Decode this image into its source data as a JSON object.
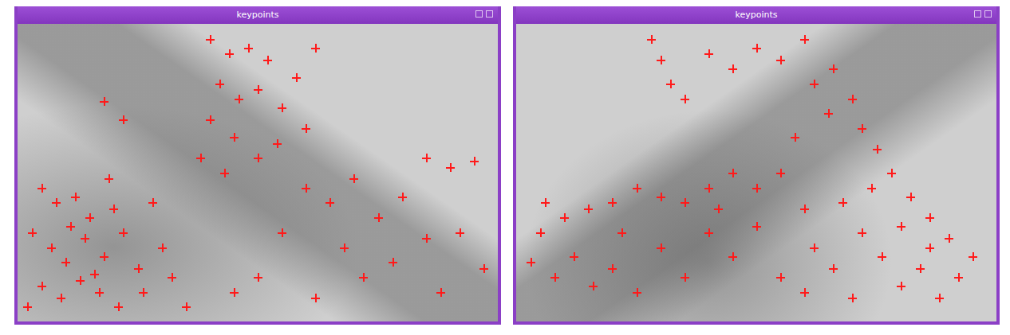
{
  "windows": [
    {
      "title": "keypoints",
      "keypoints": [
        [
          0.05,
          0.55
        ],
        [
          0.08,
          0.6
        ],
        [
          0.12,
          0.58
        ],
        [
          0.15,
          0.65
        ],
        [
          0.03,
          0.7
        ],
        [
          0.07,
          0.75
        ],
        [
          0.1,
          0.8
        ],
        [
          0.14,
          0.72
        ],
        [
          0.18,
          0.78
        ],
        [
          0.2,
          0.62
        ],
        [
          0.22,
          0.7
        ],
        [
          0.25,
          0.82
        ],
        [
          0.05,
          0.88
        ],
        [
          0.09,
          0.92
        ],
        [
          0.13,
          0.86
        ],
        [
          0.17,
          0.9
        ],
        [
          0.21,
          0.95
        ],
        [
          0.26,
          0.9
        ],
        [
          0.3,
          0.75
        ],
        [
          0.32,
          0.85
        ],
        [
          0.28,
          0.6
        ],
        [
          0.35,
          0.95
        ],
        [
          0.02,
          0.95
        ],
        [
          0.11,
          0.68
        ],
        [
          0.19,
          0.52
        ],
        [
          0.16,
          0.84
        ],
        [
          0.4,
          0.05
        ],
        [
          0.44,
          0.1
        ],
        [
          0.48,
          0.08
        ],
        [
          0.52,
          0.12
        ],
        [
          0.42,
          0.2
        ],
        [
          0.46,
          0.25
        ],
        [
          0.5,
          0.22
        ],
        [
          0.55,
          0.28
        ],
        [
          0.58,
          0.18
        ],
        [
          0.4,
          0.32
        ],
        [
          0.45,
          0.38
        ],
        [
          0.5,
          0.45
        ],
        [
          0.38,
          0.45
        ],
        [
          0.43,
          0.5
        ],
        [
          0.54,
          0.4
        ],
        [
          0.6,
          0.35
        ],
        [
          0.62,
          0.08
        ],
        [
          0.18,
          0.26
        ],
        [
          0.22,
          0.32
        ],
        [
          0.6,
          0.55
        ],
        [
          0.65,
          0.6
        ],
        [
          0.7,
          0.52
        ],
        [
          0.75,
          0.65
        ],
        [
          0.8,
          0.58
        ],
        [
          0.85,
          0.45
        ],
        [
          0.9,
          0.48
        ],
        [
          0.95,
          0.46
        ],
        [
          0.68,
          0.75
        ],
        [
          0.72,
          0.85
        ],
        [
          0.78,
          0.8
        ],
        [
          0.85,
          0.72
        ],
        [
          0.92,
          0.7
        ],
        [
          0.55,
          0.7
        ],
        [
          0.5,
          0.85
        ],
        [
          0.45,
          0.9
        ],
        [
          0.62,
          0.92
        ],
        [
          0.88,
          0.9
        ],
        [
          0.97,
          0.82
        ]
      ]
    },
    {
      "title": "keypoints",
      "keypoints": [
        [
          0.28,
          0.05
        ],
        [
          0.3,
          0.12
        ],
        [
          0.32,
          0.2
        ],
        [
          0.35,
          0.25
        ],
        [
          0.4,
          0.1
        ],
        [
          0.45,
          0.15
        ],
        [
          0.5,
          0.08
        ],
        [
          0.55,
          0.12
        ],
        [
          0.6,
          0.05
        ],
        [
          0.62,
          0.2
        ],
        [
          0.66,
          0.15
        ],
        [
          0.7,
          0.25
        ],
        [
          0.72,
          0.35
        ],
        [
          0.75,
          0.42
        ],
        [
          0.78,
          0.5
        ],
        [
          0.82,
          0.58
        ],
        [
          0.86,
          0.65
        ],
        [
          0.9,
          0.72
        ],
        [
          0.65,
          0.3
        ],
        [
          0.58,
          0.38
        ],
        [
          0.55,
          0.5
        ],
        [
          0.5,
          0.55
        ],
        [
          0.45,
          0.5
        ],
        [
          0.4,
          0.55
        ],
        [
          0.35,
          0.6
        ],
        [
          0.3,
          0.58
        ],
        [
          0.25,
          0.55
        ],
        [
          0.2,
          0.6
        ],
        [
          0.15,
          0.62
        ],
        [
          0.1,
          0.65
        ],
        [
          0.05,
          0.7
        ],
        [
          0.03,
          0.8
        ],
        [
          0.08,
          0.85
        ],
        [
          0.12,
          0.78
        ],
        [
          0.16,
          0.88
        ],
        [
          0.2,
          0.82
        ],
        [
          0.25,
          0.9
        ],
        [
          0.3,
          0.75
        ],
        [
          0.35,
          0.85
        ],
        [
          0.4,
          0.7
        ],
        [
          0.45,
          0.78
        ],
        [
          0.22,
          0.7
        ],
        [
          0.55,
          0.85
        ],
        [
          0.6,
          0.9
        ],
        [
          0.62,
          0.75
        ],
        [
          0.66,
          0.82
        ],
        [
          0.7,
          0.92
        ],
        [
          0.72,
          0.7
        ],
        [
          0.76,
          0.78
        ],
        [
          0.8,
          0.88
        ],
        [
          0.84,
          0.82
        ],
        [
          0.88,
          0.92
        ],
        [
          0.92,
          0.85
        ],
        [
          0.95,
          0.78
        ],
        [
          0.68,
          0.6
        ],
        [
          0.74,
          0.55
        ],
        [
          0.8,
          0.68
        ],
        [
          0.86,
          0.75
        ],
        [
          0.6,
          0.62
        ],
        [
          0.5,
          0.68
        ],
        [
          0.42,
          0.62
        ],
        [
          0.06,
          0.6
        ]
      ]
    }
  ]
}
